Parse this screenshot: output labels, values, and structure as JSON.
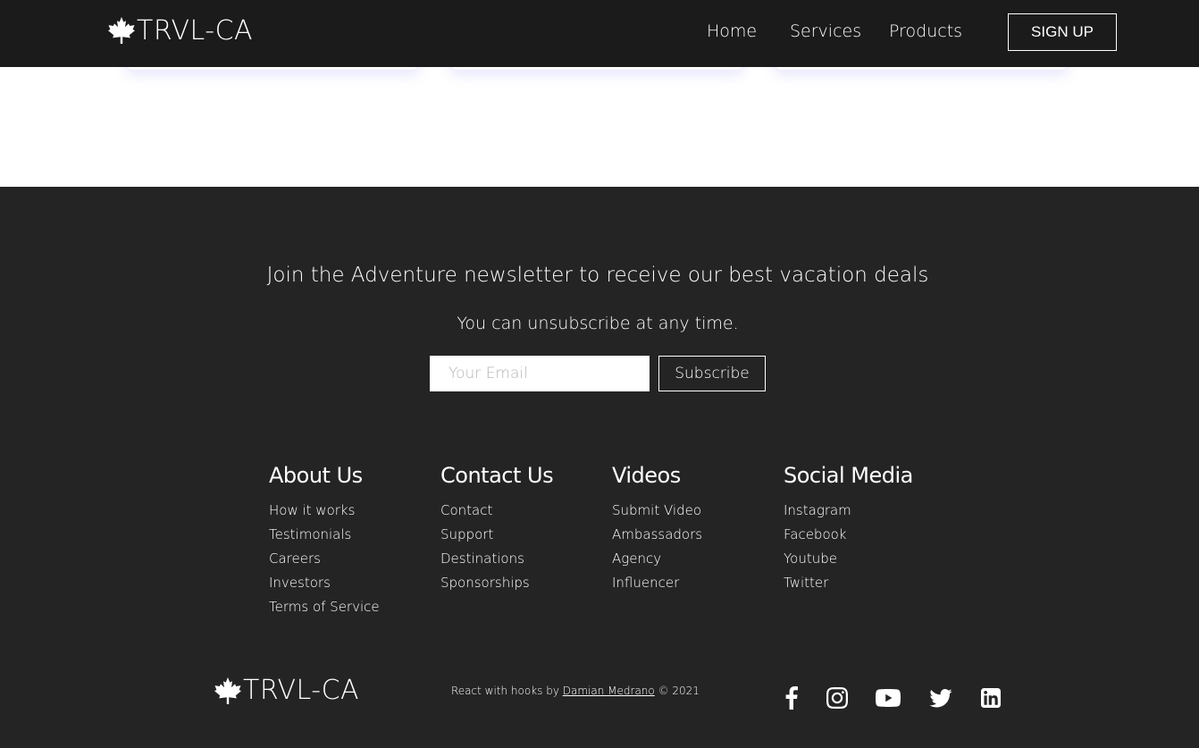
{
  "navbar": {
    "logo_text": "TRVL-CA",
    "links": [
      "Home",
      "Services",
      "Products"
    ],
    "signup_label": "SIGN UP"
  },
  "newsletter": {
    "heading": "Join the Adventure newsletter to receive our best vacation deals",
    "subtext": "You can unsubscribe at any time.",
    "email_placeholder": "Your Email",
    "subscribe_label": "Subscribe"
  },
  "footer_columns": [
    {
      "title": "About Us",
      "links": [
        "How it works",
        "Testimonials",
        "Careers",
        "Investors",
        "Terms of Service"
      ]
    },
    {
      "title": "Contact Us",
      "links": [
        "Contact",
        "Support",
        "Destinations",
        "Sponsorships"
      ]
    },
    {
      "title": "Videos",
      "links": [
        "Submit Video",
        "Ambassadors",
        "Agency",
        "Influencer"
      ]
    },
    {
      "title": "Social Media",
      "links": [
        "Instagram",
        "Facebook",
        "Youtube",
        "Twitter"
      ]
    }
  ],
  "footer_bottom": {
    "logo_text": "TRVL-CA",
    "credit_prefix": "React with hooks by ",
    "credit_author": "Damian Medrano",
    "credit_suffix": " © 2021",
    "social_icons": [
      "facebook-icon",
      "instagram-icon",
      "youtube-icon",
      "twitter-icon",
      "linkedin-icon"
    ]
  },
  "colors": {
    "navbar_bg": "#1c1b1b",
    "footer_bg": "#242424",
    "text": "#ffffff"
  }
}
